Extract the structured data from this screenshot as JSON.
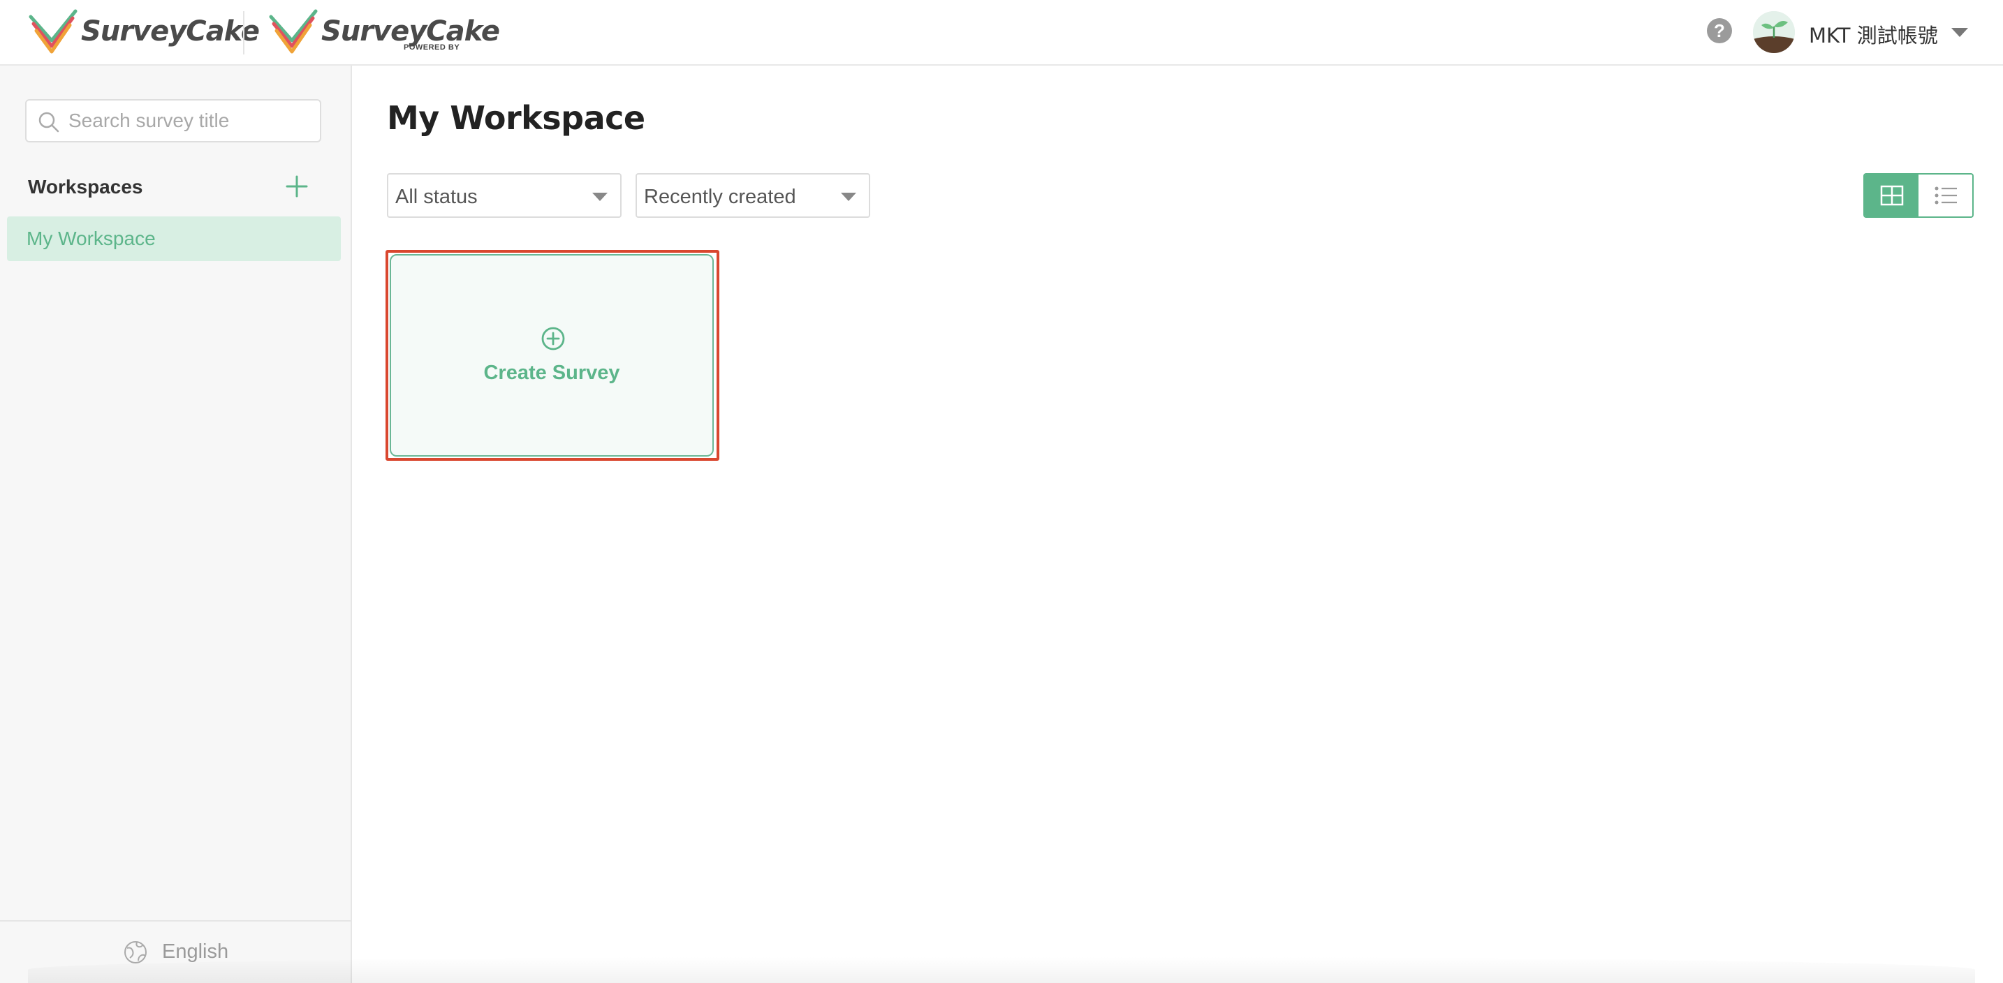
{
  "header": {
    "logo_primary": {
      "text": "SurveyCake"
    },
    "logo_secondary": {
      "text": "SurveyCake",
      "subtext": "POWERED BY"
    },
    "help_icon": "question-circle-icon",
    "user": {
      "name": "MKT 測試帳號",
      "avatar_icon": "sprout-avatar"
    }
  },
  "sidebar": {
    "search": {
      "placeholder": "Search survey title",
      "value": ""
    },
    "workspaces_heading": "Workspaces",
    "add_icon": "plus-icon",
    "items": [
      {
        "label": "My Workspace",
        "selected": true
      }
    ],
    "footer": {
      "language": "English",
      "icon": "globe-icon"
    }
  },
  "main": {
    "title": "My Workspace",
    "filters": {
      "status": {
        "selected": "All status"
      },
      "sort": {
        "selected": "Recently created"
      }
    },
    "view_toggle": {
      "active": "grid",
      "options": [
        "grid",
        "list"
      ]
    },
    "create_card": {
      "label": "Create Survey",
      "icon": "plus-circle-icon",
      "highlighted": true
    }
  },
  "colors": {
    "accent": "#5cb58a",
    "selected_bg": "#d8efe3",
    "highlight_border": "#d9472f",
    "sidebar_bg": "#f7f7f7"
  }
}
